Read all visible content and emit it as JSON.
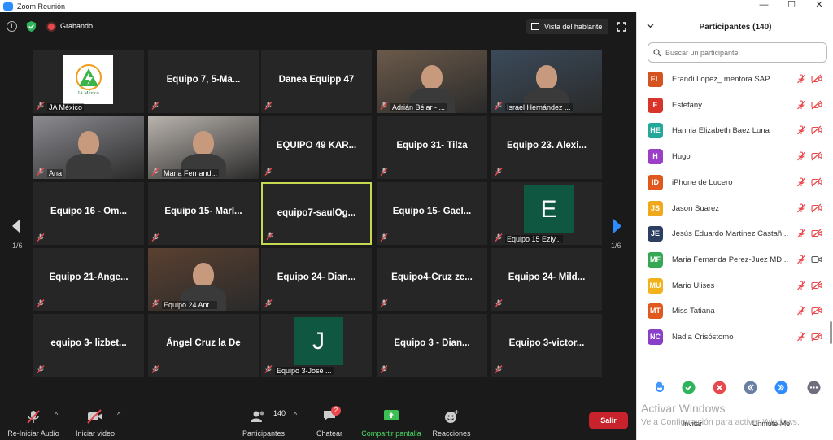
{
  "window": {
    "title": "Zoom Reunión",
    "controls": [
      "—",
      "☐",
      "✕"
    ]
  },
  "topbar": {
    "recording_label": "Grabando",
    "view_button": "Vista del hablante"
  },
  "gallery": {
    "page_left": "1/6",
    "page_right": "1/6",
    "tiles": [
      {
        "label": "",
        "caption": "JA México",
        "kind": "logo",
        "logo_text": "JA México"
      },
      {
        "label": "Equipo 7, 5-Ma...",
        "caption": ""
      },
      {
        "label": "Danea Equipp 47",
        "caption": ""
      },
      {
        "label": "",
        "caption": "Adrián Béjar - ...",
        "kind": "photo"
      },
      {
        "label": "",
        "caption": "Israel Hernández ...",
        "kind": "photo"
      },
      {
        "label": "",
        "caption": "Ana",
        "kind": "photo"
      },
      {
        "label": "",
        "caption": "Maria Fernand...",
        "kind": "photo"
      },
      {
        "label": "EQUIPO 49 KAR...",
        "caption": ""
      },
      {
        "label": "Equipo 31- Tilza",
        "caption": ""
      },
      {
        "label": "Equipo 23. Alexi...",
        "caption": ""
      },
      {
        "label": "Equipo 16 - Om...",
        "caption": ""
      },
      {
        "label": "Equipo 15- Marl...",
        "caption": ""
      },
      {
        "label": "equipo7-saulOg...",
        "caption": "",
        "active": true
      },
      {
        "label": "Equipo 15- Gael...",
        "caption": ""
      },
      {
        "label": "",
        "caption": "Equipo 15 Ezly...",
        "kind": "avatar",
        "avatar_letter": "E",
        "avatar_color": "#0f5740"
      },
      {
        "label": "Equipo 21-Ange...",
        "caption": ""
      },
      {
        "label": "",
        "caption": "Equipo 24 Ant...",
        "kind": "photo"
      },
      {
        "label": "Equipo 24- Dian...",
        "caption": ""
      },
      {
        "label": "Equipo4-Cruz ze...",
        "caption": ""
      },
      {
        "label": "Equipo 24- Mild...",
        "caption": ""
      },
      {
        "label": "equipo 3- lizbet...",
        "caption": ""
      },
      {
        "label": "Ángel Cruz la De",
        "caption": ""
      },
      {
        "label": "",
        "caption": "Equipo 3-José ...",
        "kind": "avatar",
        "avatar_letter": "J",
        "avatar_color": "#0f5740"
      },
      {
        "label": "Equipo 3 - Dian...",
        "caption": ""
      },
      {
        "label": "Equipo 3-victor...",
        "caption": ""
      }
    ]
  },
  "toolbar": {
    "unmute_label": "Re-Iniciar Audio",
    "video_label": "Iniciar video",
    "participants_label": "Participantes",
    "participants_count": "140",
    "chat_label": "Chatear",
    "chat_badge": "2",
    "share_label": "Compartir pantalla",
    "reactions_label": "Reacciones",
    "leave_label": "Salir"
  },
  "panel": {
    "title": "Participantes (140)",
    "search_placeholder": "Buscar un participante",
    "participants": [
      {
        "initials": "EL",
        "name": "Erandi Lopez_ mentora SAP",
        "color": "#d4531f",
        "video": "off"
      },
      {
        "initials": "E",
        "name": "Estefany",
        "color": "#d8342c",
        "video": "off"
      },
      {
        "initials": "HE",
        "name": "Hannia Elizabeth Baez Luna",
        "color": "#23a89a",
        "video": "off"
      },
      {
        "initials": "H",
        "name": "Hugo",
        "color": "#9b3fc8",
        "video": "off"
      },
      {
        "initials": "ID",
        "name": "iPhone de Lucero",
        "color": "#e0581d",
        "video": "off"
      },
      {
        "initials": "JS",
        "name": "Jason Suarez",
        "color": "#f0a81d",
        "video": "off"
      },
      {
        "initials": "JE",
        "name": "Jesús Eduardo Martinez Castañ...",
        "color": "#2d3e63",
        "video": "off"
      },
      {
        "initials": "MF",
        "name": "Maria Fernanda Perez-Juez MD...",
        "color": "#35a853",
        "video": "on"
      },
      {
        "initials": "MU",
        "name": "Mario Ulises",
        "color": "#f2b21c",
        "video": "off"
      },
      {
        "initials": "MT",
        "name": "Miss Tatiana",
        "color": "#e0581d",
        "video": "off"
      },
      {
        "initials": "NC",
        "name": "Nadia Crisóstomo",
        "color": "#8a3fc8",
        "video": "off"
      }
    ],
    "footer": {
      "invite": "Invitar",
      "unmute_me": "Unmute Me"
    },
    "watermark_line1": "Activar Windows",
    "watermark_line2": "Ve a Configuración para activar Windows."
  }
}
